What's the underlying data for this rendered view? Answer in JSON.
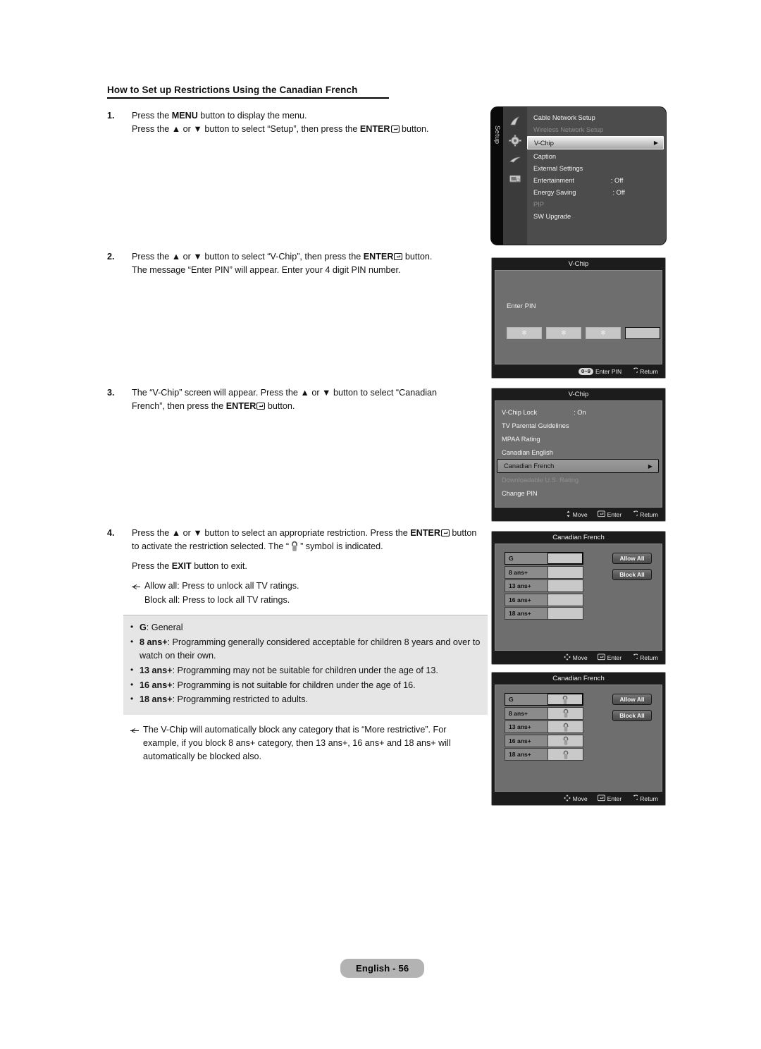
{
  "page": {
    "heading": "How to Set up Restrictions Using the Canadian French",
    "footer": "English - 56"
  },
  "steps": [
    {
      "num": "1.",
      "line1_a": "Press the ",
      "line1_b": "MENU",
      "line1_c": " button to display the menu.",
      "line2_a": "Press the ▲ or ▼ button to select “Setup”, then press the ",
      "line2_b": "ENTER",
      "line2_c": " button."
    },
    {
      "num": "2.",
      "line1_a": "Press the ▲ or ▼ button to select “V-Chip”, then press the ",
      "line1_b": "ENTER",
      "line1_c": " button.",
      "line2": "The message “Enter PIN” will appear. Enter your 4 digit PIN number."
    },
    {
      "num": "3.",
      "line1_a": "The “V-Chip” screen will appear. Press the ▲ or ▼ button to select “Canadian French”, then press the ",
      "line1_b": "ENTER",
      "line1_c": " button."
    },
    {
      "num": "4.",
      "line1_a": "Press the ▲ or ▼ button to select an appropriate restriction. Press the ",
      "line1_b": "ENTER",
      "line1_c": " button to activate the restriction selected. The “",
      "line1_d": "” symbol is indicated.",
      "line2_a": "Press the ",
      "line2_b": "EXIT",
      "line2_c": " button to exit.",
      "note1": "Allow all: Press to unlock all TV ratings.",
      "note2": "Block all: Press to lock all TV ratings."
    }
  ],
  "notes": {
    "items": [
      {
        "term": "G",
        "desc": ": General"
      },
      {
        "term": "8 ans+",
        "desc": ": Programming generally considered acceptable for children 8 years and over to watch on their own."
      },
      {
        "term": "13 ans+",
        "desc": ": Programming may not be suitable for children under the age of 13."
      },
      {
        "term": "16 ans+",
        "desc": ": Programming is not suitable for children under the age of 16."
      },
      {
        "term": "18 ans+",
        "desc": ": Programming restricted to adults."
      }
    ]
  },
  "tail_note": "The V-Chip will automatically block any category that is “More restrictive”. For example, if you block 8 ans+ category, then 13 ans+, 16 ans+ and 18 ans+ will automatically be blocked also.",
  "osd": {
    "setup_menu": {
      "tab_label": "Setup",
      "items": [
        {
          "label": "Cable Network Setup",
          "value": "",
          "state": "normal"
        },
        {
          "label": "Wireless Network Setup",
          "value": "",
          "state": "dim"
        },
        {
          "label": "V-Chip",
          "value": "",
          "state": "selected"
        },
        {
          "label": "Caption",
          "value": "",
          "state": "normal"
        },
        {
          "label": "External Settings",
          "value": "",
          "state": "normal"
        },
        {
          "label": "Entertainment",
          "value": ": Off",
          "state": "normal"
        },
        {
          "label": "Energy Saving",
          "value": ": Off",
          "state": "normal"
        },
        {
          "label": "PIP",
          "value": "",
          "state": "dim"
        },
        {
          "label": "SW Upgrade",
          "value": "",
          "state": "normal"
        }
      ]
    },
    "pin_dialog": {
      "title": "V-Chip",
      "label": "Enter PIN",
      "digits": [
        "✻",
        "✻",
        "✻",
        ""
      ],
      "footer": [
        {
          "key": "0~9",
          "label": "Enter PIN"
        },
        {
          "key": "return-icon",
          "label": "Return"
        }
      ]
    },
    "vchip_dialog": {
      "title": "V-Chip",
      "items": [
        {
          "label": "V-Chip Lock",
          "value": ": On",
          "state": "normal"
        },
        {
          "label": "TV Parental Guidelines",
          "value": "",
          "state": "normal"
        },
        {
          "label": "MPAA Rating",
          "value": "",
          "state": "normal"
        },
        {
          "label": "Canadian English",
          "value": "",
          "state": "normal"
        },
        {
          "label": "Canadian French",
          "value": "",
          "state": "selected"
        },
        {
          "label": "Downloadable U.S. Rating",
          "value": "",
          "state": "dim"
        },
        {
          "label": "Change PIN",
          "value": "",
          "state": "normal"
        }
      ],
      "footer": [
        {
          "key": "move-icon",
          "label": "Move"
        },
        {
          "key": "enter-icon",
          "label": "Enter"
        },
        {
          "key": "return-icon",
          "label": "Return"
        }
      ]
    },
    "cf_unlocked": {
      "title": "Canadian French",
      "rows": [
        {
          "name": "G",
          "locked": false,
          "selected": true
        },
        {
          "name": "8 ans+",
          "locked": false,
          "selected": false
        },
        {
          "name": "13 ans+",
          "locked": false,
          "selected": false
        },
        {
          "name": "16 ans+",
          "locked": false,
          "selected": false
        },
        {
          "name": "18 ans+",
          "locked": false,
          "selected": false
        }
      ],
      "allow_all": "Allow All",
      "block_all": "Block All",
      "footer": [
        {
          "key": "move-icon",
          "label": "Move"
        },
        {
          "key": "enter-icon",
          "label": "Enter"
        },
        {
          "key": "return-icon",
          "label": "Return"
        }
      ]
    },
    "cf_locked": {
      "title": "Canadian French",
      "rows": [
        {
          "name": "G",
          "locked": true,
          "selected": true
        },
        {
          "name": "8 ans+",
          "locked": true,
          "selected": false
        },
        {
          "name": "13 ans+",
          "locked": true,
          "selected": false
        },
        {
          "name": "16 ans+",
          "locked": true,
          "selected": false
        },
        {
          "name": "18 ans+",
          "locked": true,
          "selected": false
        }
      ],
      "allow_all": "Allow All",
      "block_all": "Block All",
      "footer": [
        {
          "key": "move-icon",
          "label": "Move"
        },
        {
          "key": "enter-icon",
          "label": "Enter"
        },
        {
          "key": "return-icon",
          "label": "Return"
        }
      ]
    }
  }
}
